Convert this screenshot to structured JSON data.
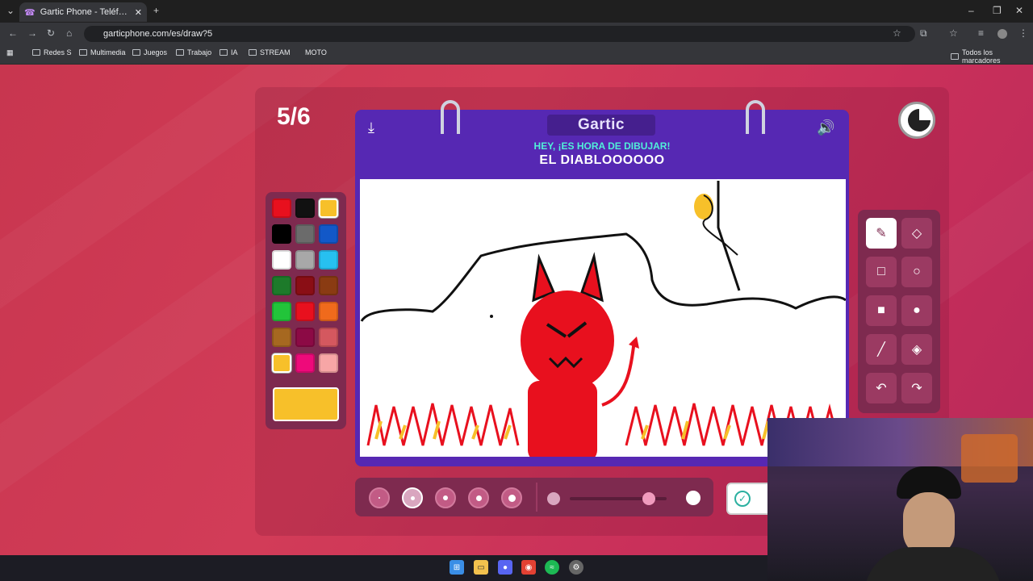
{
  "browser": {
    "tab_title": "Gartic Phone - Teléfono Descon",
    "url": "garticphone.com/es/draw?5",
    "bookmarks": [
      "Redes S",
      "Multimedia",
      "Juegos",
      "Trabajo",
      "IA",
      "STREAM",
      "MOTO"
    ],
    "all_bookmarks": "Todos los marcadores"
  },
  "game": {
    "round": "5/6",
    "logo": "Gartic",
    "prompt": "HEY, ¡ES HORA DE DIBUJAR!",
    "word": "EL DIABLOOOOOO",
    "selected_color": "#f7c02a",
    "palette": [
      "#e8101e",
      "#111111",
      "#f7c02a",
      "#000000",
      "#6b6b6b",
      "#1258c8",
      "#ffffff",
      "#a8a8a8",
      "#27c0f0",
      "#1d7a2a",
      "#8a0e15",
      "#8a3b12",
      "#22c43a",
      "#e8101e",
      "#f06a1c",
      "#a66820",
      "#8c0a45",
      "#d4585f",
      "#f7c02a",
      "#ee0a7a",
      "#f7a6a6"
    ],
    "tools": [
      "pencil",
      "eraser",
      "rectangle-outline",
      "circle-outline",
      "rectangle-filled",
      "circle-filled",
      "line",
      "fill-bucket",
      "undo",
      "redo"
    ],
    "brush_sizes": 5,
    "selected_brush_size": 2,
    "opacity_slider": 0.82
  }
}
